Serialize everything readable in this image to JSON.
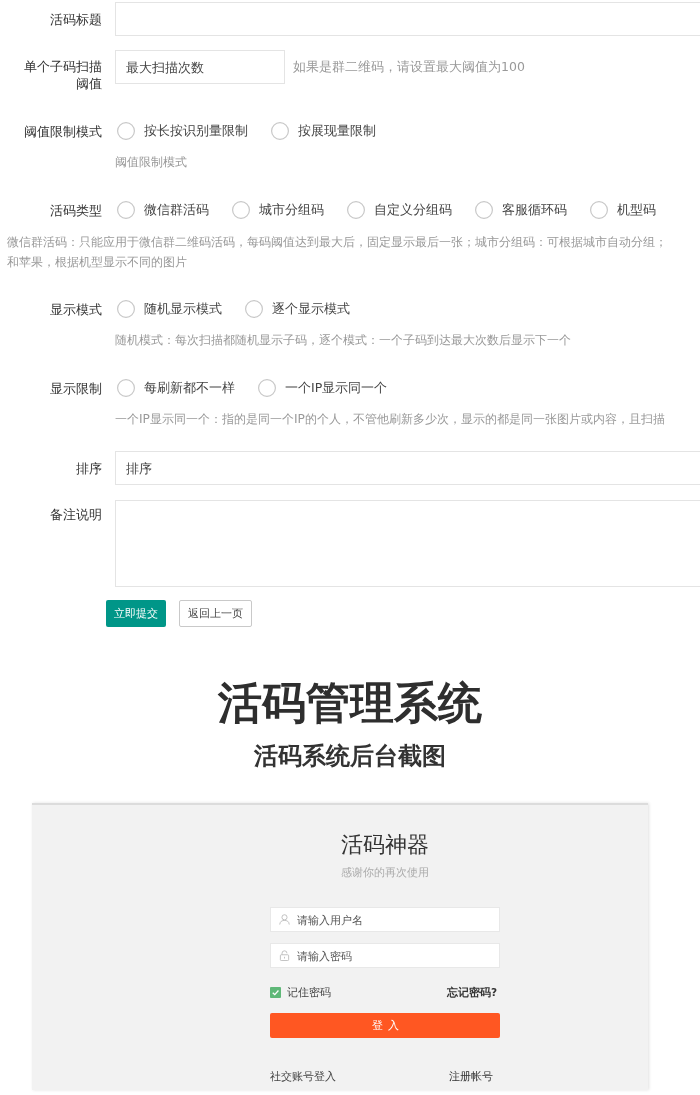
{
  "form": {
    "fields": [
      {
        "kind": "input",
        "label": "活码标题"
      },
      {
        "kind": "short",
        "label": "单个子码扫描阈值",
        "placeholder": "最大扫描次数",
        "hint": "如果是群二维码，请设置最大阈值为100"
      },
      {
        "kind": "radios",
        "label": "阈值限制模式",
        "options": [
          {
            "label": "按长按识别量限制",
            "selected": false
          },
          {
            "label": "按展现量限制",
            "selected": false
          }
        ],
        "help": "阈值限制模式"
      },
      {
        "kind": "radios",
        "label": "活码类型",
        "options": [
          {
            "label": "微信群活码",
            "selected": false
          },
          {
            "label": "城市分组码",
            "selected": false
          },
          {
            "label": "自定义分组码",
            "selected": false
          },
          {
            "label": "客服循环码",
            "selected": false
          },
          {
            "label": "机型码",
            "selected": false
          }
        ]
      },
      {
        "kind": "note",
        "lines": [
          "微信群活码：只能应用于微信群二维码活码，每码阈值达到最大后，固定显示最后一张；城市分组码：可根据城市自动分组；",
          "和苹果，根据机型显示不同的图片"
        ]
      },
      {
        "kind": "radios",
        "label": "显示模式",
        "options": [
          {
            "label": "随机显示模式",
            "selected": false
          },
          {
            "label": "逐个显示模式",
            "selected": false
          }
        ],
        "help": "随机模式：每次扫描都随机显示子码，逐个模式：一个子码到达最大次数后显示下一个"
      },
      {
        "kind": "radios",
        "label": "显示限制",
        "options": [
          {
            "label": "每刷新都不一样",
            "selected": false
          },
          {
            "label": "一个IP显示同一个",
            "selected": false
          }
        ],
        "help": "一个IP显示同一个：指的是同一个IP的个人，不管他刷新多少次，显示的都是同一张图片或内容，且扫描"
      },
      {
        "kind": "input",
        "label": "排序",
        "placeholder": "排序"
      },
      {
        "kind": "textarea",
        "label": "备注说明"
      }
    ],
    "buttons": [
      {
        "kind": "primary",
        "label": "立即提交"
      },
      {
        "kind": "secondary",
        "label": "返回上一页"
      }
    ]
  },
  "caption": {
    "title": "活码管理系统",
    "subtitle": "活码系统后台截图"
  },
  "login": {
    "title": "活码神器",
    "subtitle": "感谢你的再次使用",
    "fields": [
      {
        "kind": "user",
        "placeholder": "请输入用户名"
      },
      {
        "kind": "password",
        "placeholder": "请输入密码"
      }
    ],
    "remember": {
      "label": "记住密码",
      "checked": true
    },
    "forgot": "忘记密码?",
    "submit": "登入",
    "social": "社交账号登入",
    "register": "注册帐号"
  }
}
